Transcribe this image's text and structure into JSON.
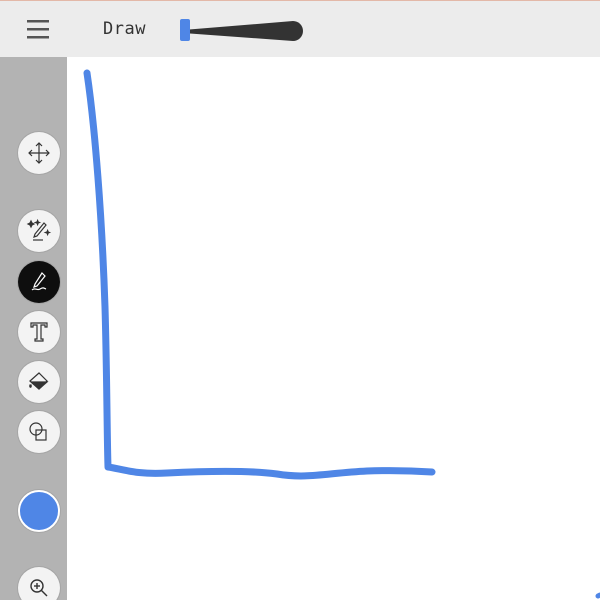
{
  "app": {
    "title": "Draw"
  },
  "brush": {
    "color": "#4f86e6"
  },
  "icons": {
    "menu": "hamburger-menu-icon",
    "move": "move-arrows-icon",
    "magic": "magic-pen-icon",
    "pen": "pen-icon",
    "text": "text-icon",
    "fill": "paint-bucket-icon",
    "shapes": "shapes-icon",
    "zoom": "zoom-in-icon"
  }
}
